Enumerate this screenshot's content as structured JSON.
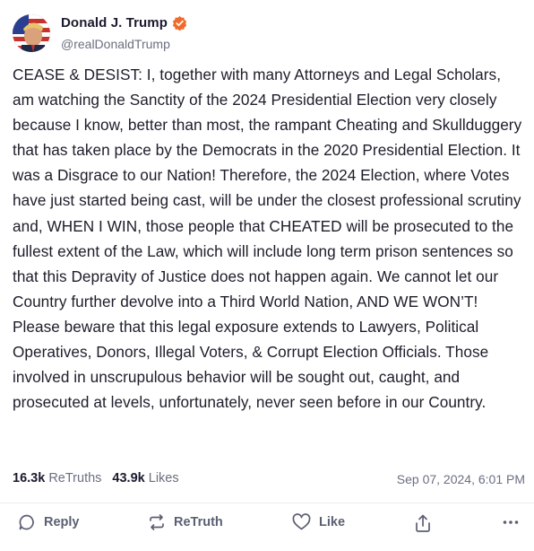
{
  "author": {
    "display_name": "Donald J. Trump",
    "handle": "@realDonaldTrump",
    "verified": true,
    "verified_color": "#f06a2b"
  },
  "post": {
    "text": "CEASE & DESIST: I, together with many Attorneys and Legal Scholars, am watching the Sanctity of the 2024 Presidential Election very closely because I know, better than most, the rampant Cheating and Skullduggery that has taken place by the Democrats in the 2020 Presidential Election. It was a Disgrace to our Nation! Therefore, the 2024 Election, where Votes have just started being cast, will be under the closest professional scrutiny and, WHEN I WIN, those people that CHEATED will be prosecuted to the fullest extent of the Law, which will include long term prison sentences so that this Depravity of Justice does not happen again. We cannot let our Country further devolve into a Third World Nation, AND WE WON’T! Please beware that this legal exposure extends to Lawyers, Political Operatives, Donors, Illegal Voters, & Corrupt Election Officials. Those involved in unscrupulous behavior will be sought out, caught, and prosecuted at levels, unfortunately, never seen before in our Country."
  },
  "stats": {
    "retruths_count": "16.3k",
    "retruths_label": "ReTruths",
    "likes_count": "43.9k",
    "likes_label": "Likes",
    "timestamp": "Sep 07, 2024, 6:01 PM"
  },
  "actions": {
    "reply_label": "Reply",
    "retruth_label": "ReTruth",
    "like_label": "Like",
    "share_icon": "share-icon",
    "more_icon": "more-icon"
  }
}
